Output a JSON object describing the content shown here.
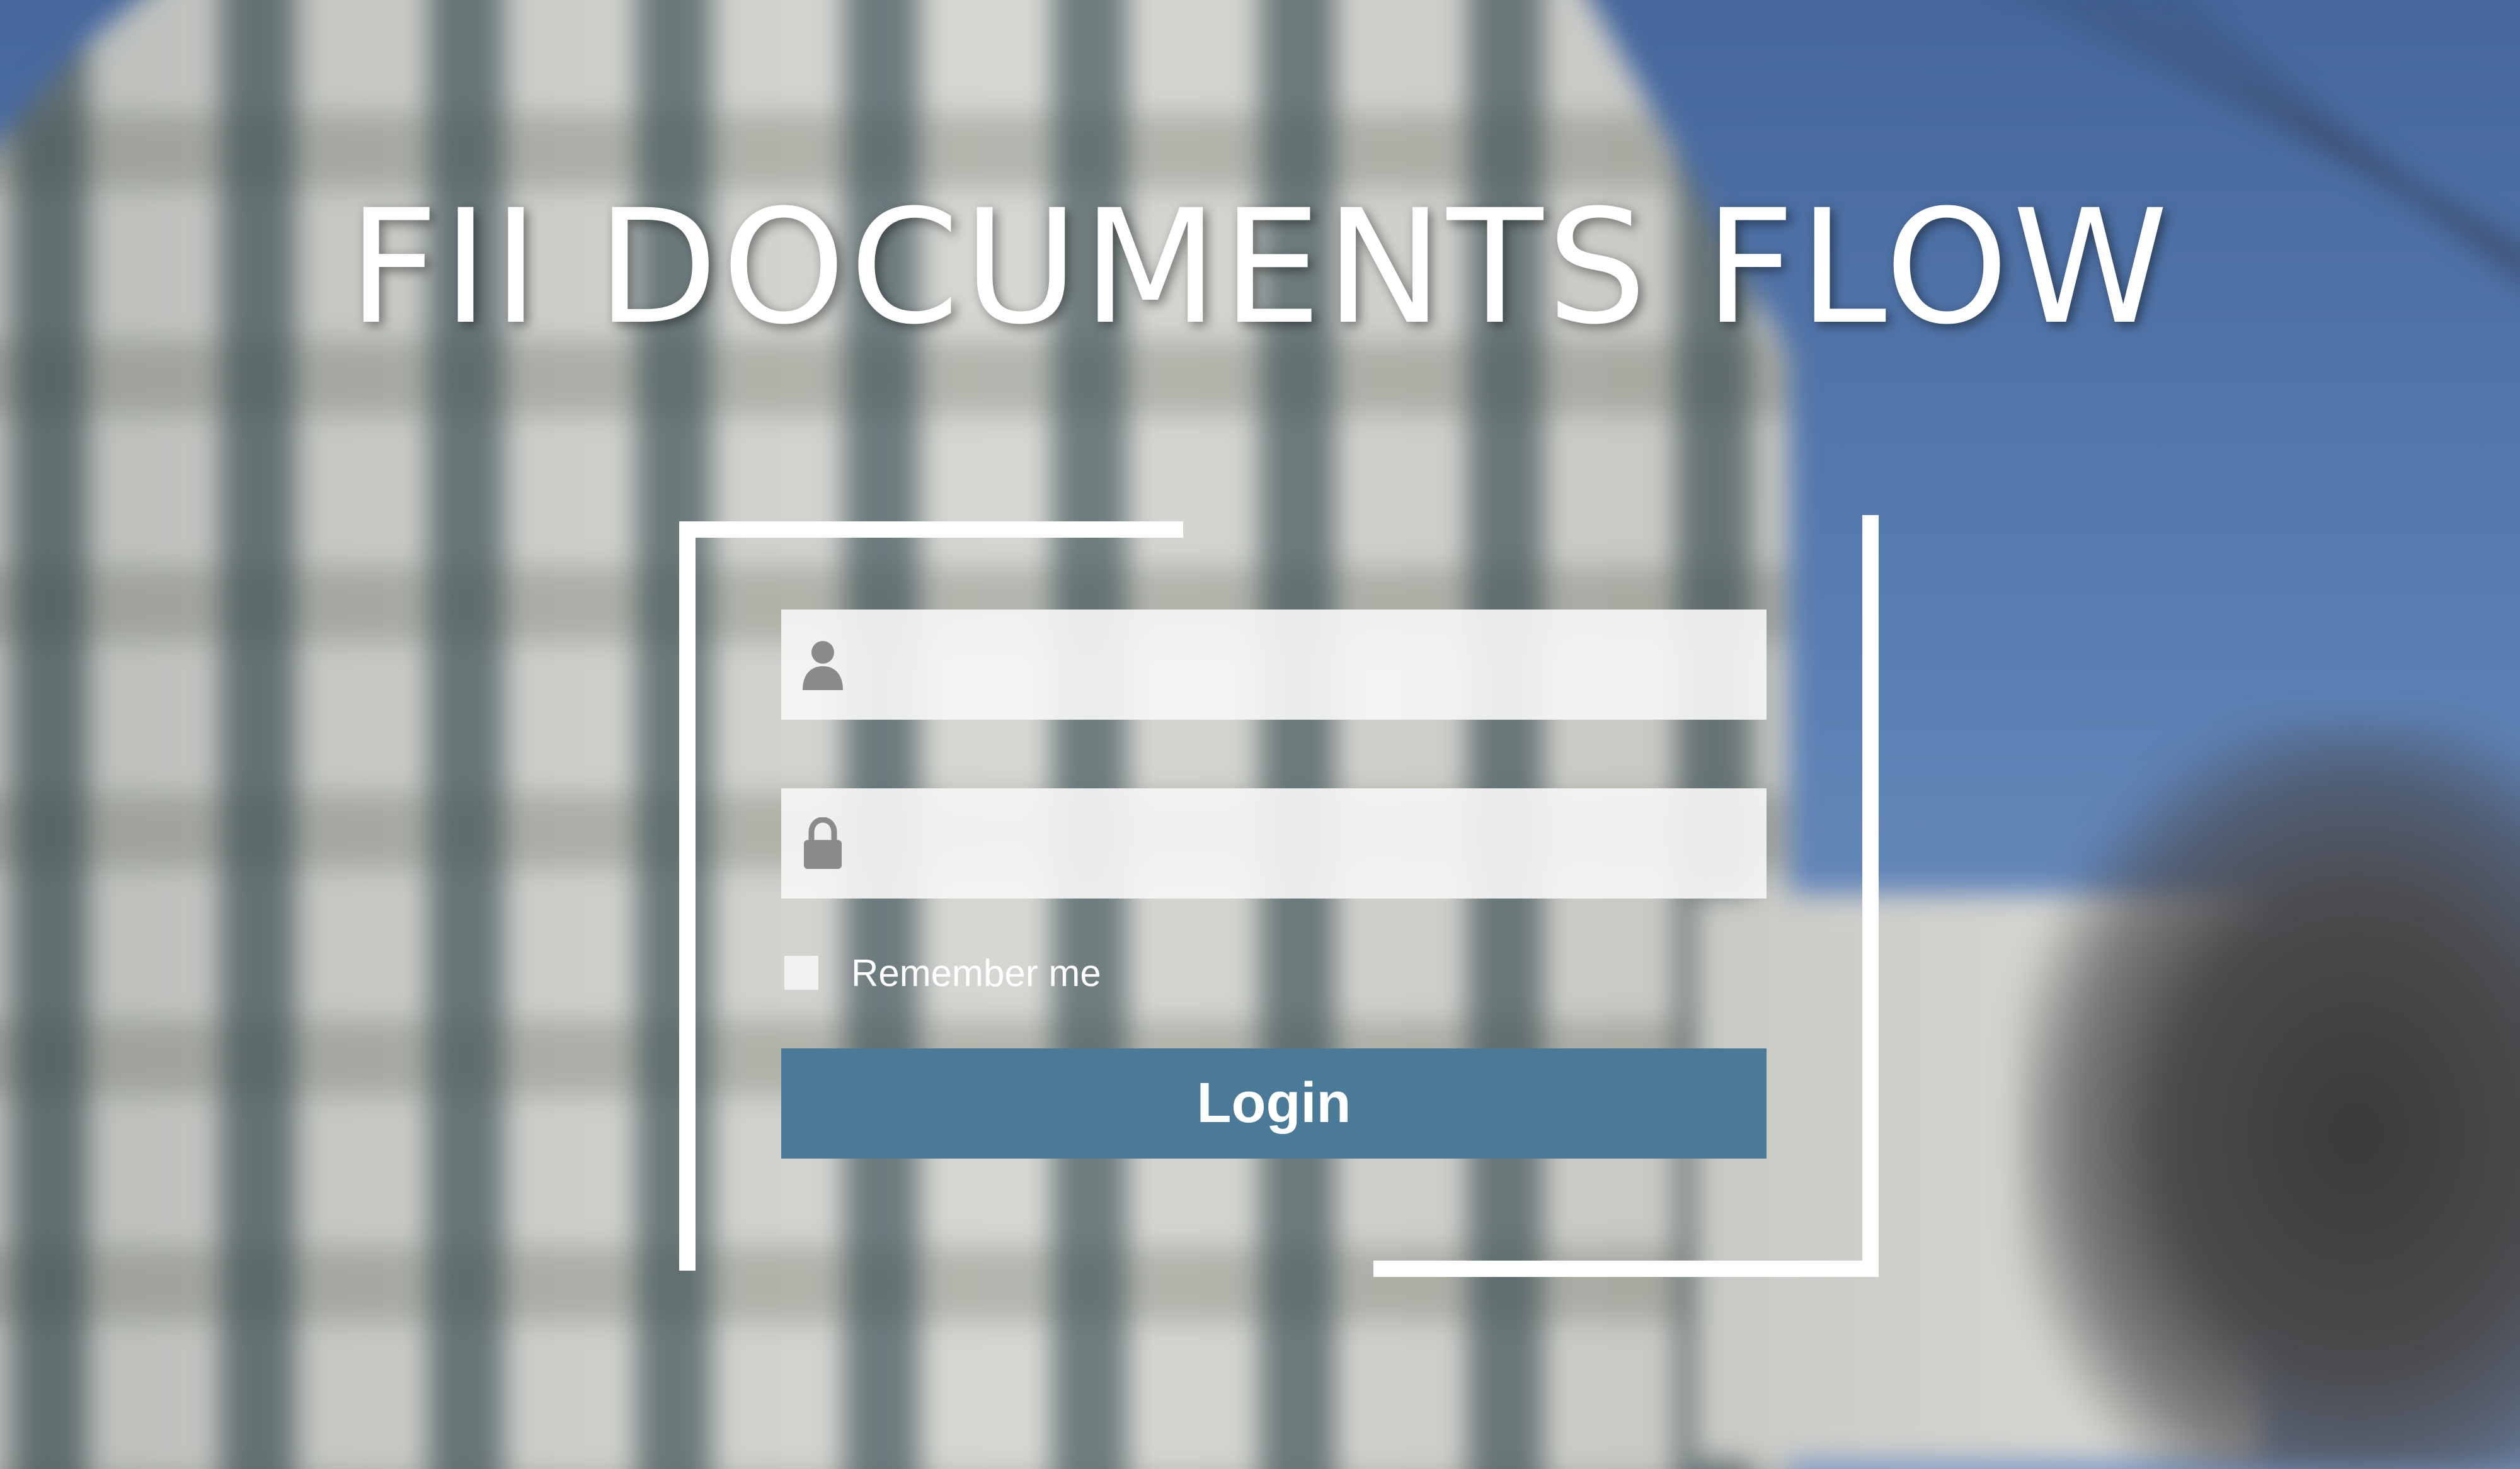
{
  "header": {
    "title": "FII DOCUMENTS FLOW"
  },
  "login_form": {
    "username": {
      "value": "",
      "placeholder": "",
      "icon": "user-icon"
    },
    "password": {
      "value": "",
      "placeholder": "",
      "icon": "lock-icon"
    },
    "remember_me": {
      "label": "Remember me",
      "checked": false
    },
    "login_button": {
      "label": "Login"
    }
  },
  "colors": {
    "button_background": "#4a7a97",
    "frame": "#ffffff",
    "field_background": "#f5f5f5",
    "icon": "#8a8a8a"
  }
}
